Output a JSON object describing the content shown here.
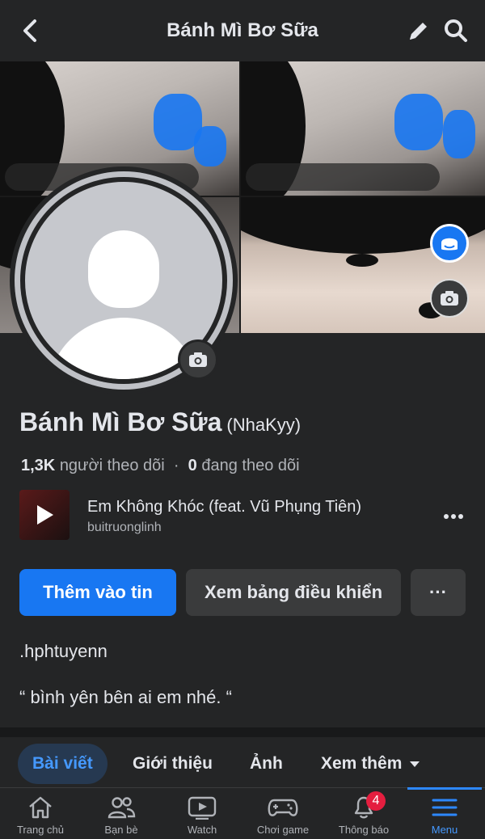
{
  "header": {
    "title": "Bánh Mì Bơ Sữa"
  },
  "profile": {
    "name": "Bánh Mì Bơ Sữa",
    "alternate_name": "(NhaKyy)",
    "followers_count": "1,3K",
    "followers_label": "người theo dõi",
    "separator": "·",
    "following_count": "0",
    "following_label": "đang theo dõi"
  },
  "music": {
    "song": "Em Không Khóc (feat. Vũ Phụng Tiên)",
    "artist": "buitruonglinh"
  },
  "actions": {
    "add_story_label": "Thêm vào tin",
    "dashboard_label": "Xem bảng điều khiển",
    "more_label": "···"
  },
  "bio": {
    "line1": ".hphtuyenn",
    "line2": "“ bình yên bên ai em nhé. “"
  },
  "tabs": [
    {
      "label": "Bài viết",
      "active": true
    },
    {
      "label": "Giới thiệu",
      "active": false
    },
    {
      "label": "Ảnh",
      "active": false
    },
    {
      "label": "Xem thêm",
      "active": false
    }
  ],
  "bottom_nav": [
    {
      "label": "Trang chủ",
      "icon": "home-icon",
      "active": false
    },
    {
      "label": "Bạn bè",
      "icon": "friends-icon",
      "active": false
    },
    {
      "label": "Watch",
      "icon": "watch-icon",
      "active": false
    },
    {
      "label": "Chơi game",
      "icon": "gaming-icon",
      "active": false
    },
    {
      "label": "Thông báo",
      "icon": "bell-icon",
      "active": false,
      "badge": "4"
    },
    {
      "label": "Menu",
      "icon": "menu-icon",
      "active": true
    }
  ],
  "colors": {
    "background": "#242526",
    "accent": "#1877f2",
    "active_tab_text": "#4599ff",
    "badge": "#e41e3f"
  }
}
